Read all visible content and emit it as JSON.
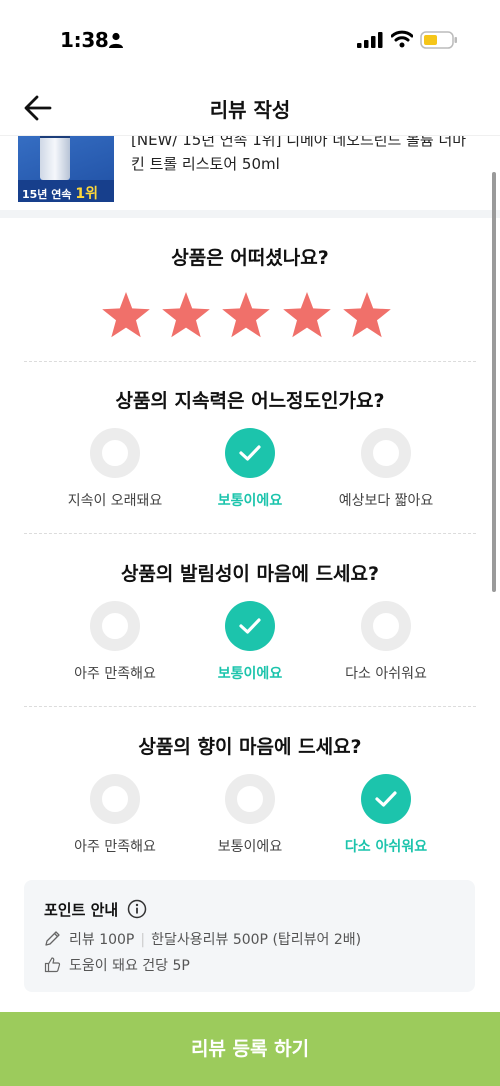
{
  "status_bar": {
    "time": "1:38"
  },
  "header": {
    "title": "리뷰 작성"
  },
  "product": {
    "name": "[NEW/ 15년 연속 1위] 디메아 네오드린드 볼륨 더마킨 트롤 리스토어 50ml",
    "thumb_badge": "15년 연속",
    "thumb_rank": "1위"
  },
  "rating": {
    "question": "상품은 어떠셨나요?",
    "stars": 5,
    "max": 5,
    "star_color": "#f0706a"
  },
  "questions": [
    {
      "title": "상품의 지속력은 어느정도인가요?",
      "options": [
        "지속이 오래돼요",
        "보통이에요",
        "예상보다 짧아요"
      ],
      "selected": 1
    },
    {
      "title": "상품의 발림성이 마음에 드세요?",
      "options": [
        "아주 만족해요",
        "보통이에요",
        "다소 아쉬워요"
      ],
      "selected": 1
    },
    {
      "title": "상품의 향이 마음에 드세요?",
      "options": [
        "아주 만족해요",
        "보통이에요",
        "다소 아쉬워요"
      ],
      "selected": 2
    }
  ],
  "points": {
    "title": "포인트 안내",
    "review_point": "리뷰 100P",
    "monthly_point": "한달사용리뷰 500P (탑리뷰어 2배)",
    "helpful_point": "도움이 돼요 건당 5P"
  },
  "submit": {
    "label": "리뷰 등록 하기"
  },
  "colors": {
    "accent": "#1cc4ac",
    "submit": "#9ccb5c",
    "star": "#f0706a"
  }
}
